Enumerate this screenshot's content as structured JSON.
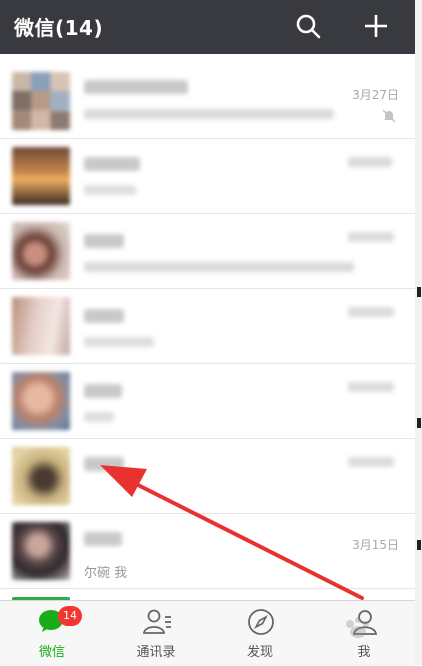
{
  "header": {
    "title": "微信(14)",
    "search_icon": "search-icon",
    "add_icon": "plus-icon"
  },
  "chats": [
    {
      "time": "3月27日",
      "preview": "",
      "muted": true
    },
    {
      "time": "",
      "preview": ""
    },
    {
      "time": "",
      "preview": ""
    },
    {
      "time": "",
      "preview": ""
    },
    {
      "time": "",
      "preview": ""
    },
    {
      "time": "",
      "preview": ""
    },
    {
      "time": "3月15日",
      "preview": "尔碗      我"
    }
  ],
  "tabs": [
    {
      "label": "微信",
      "icon": "chat-bubble-icon",
      "active": true,
      "badge": "14"
    },
    {
      "label": "通讯录",
      "icon": "contacts-icon",
      "active": false
    },
    {
      "label": "发现",
      "icon": "compass-icon",
      "active": false
    },
    {
      "label": "我",
      "icon": "person-icon",
      "active": false
    }
  ],
  "colors": {
    "accent": "#1aad19",
    "header_bg": "#393a3f",
    "badge": "#f43530",
    "annotation_arrow": "#e8322d"
  }
}
